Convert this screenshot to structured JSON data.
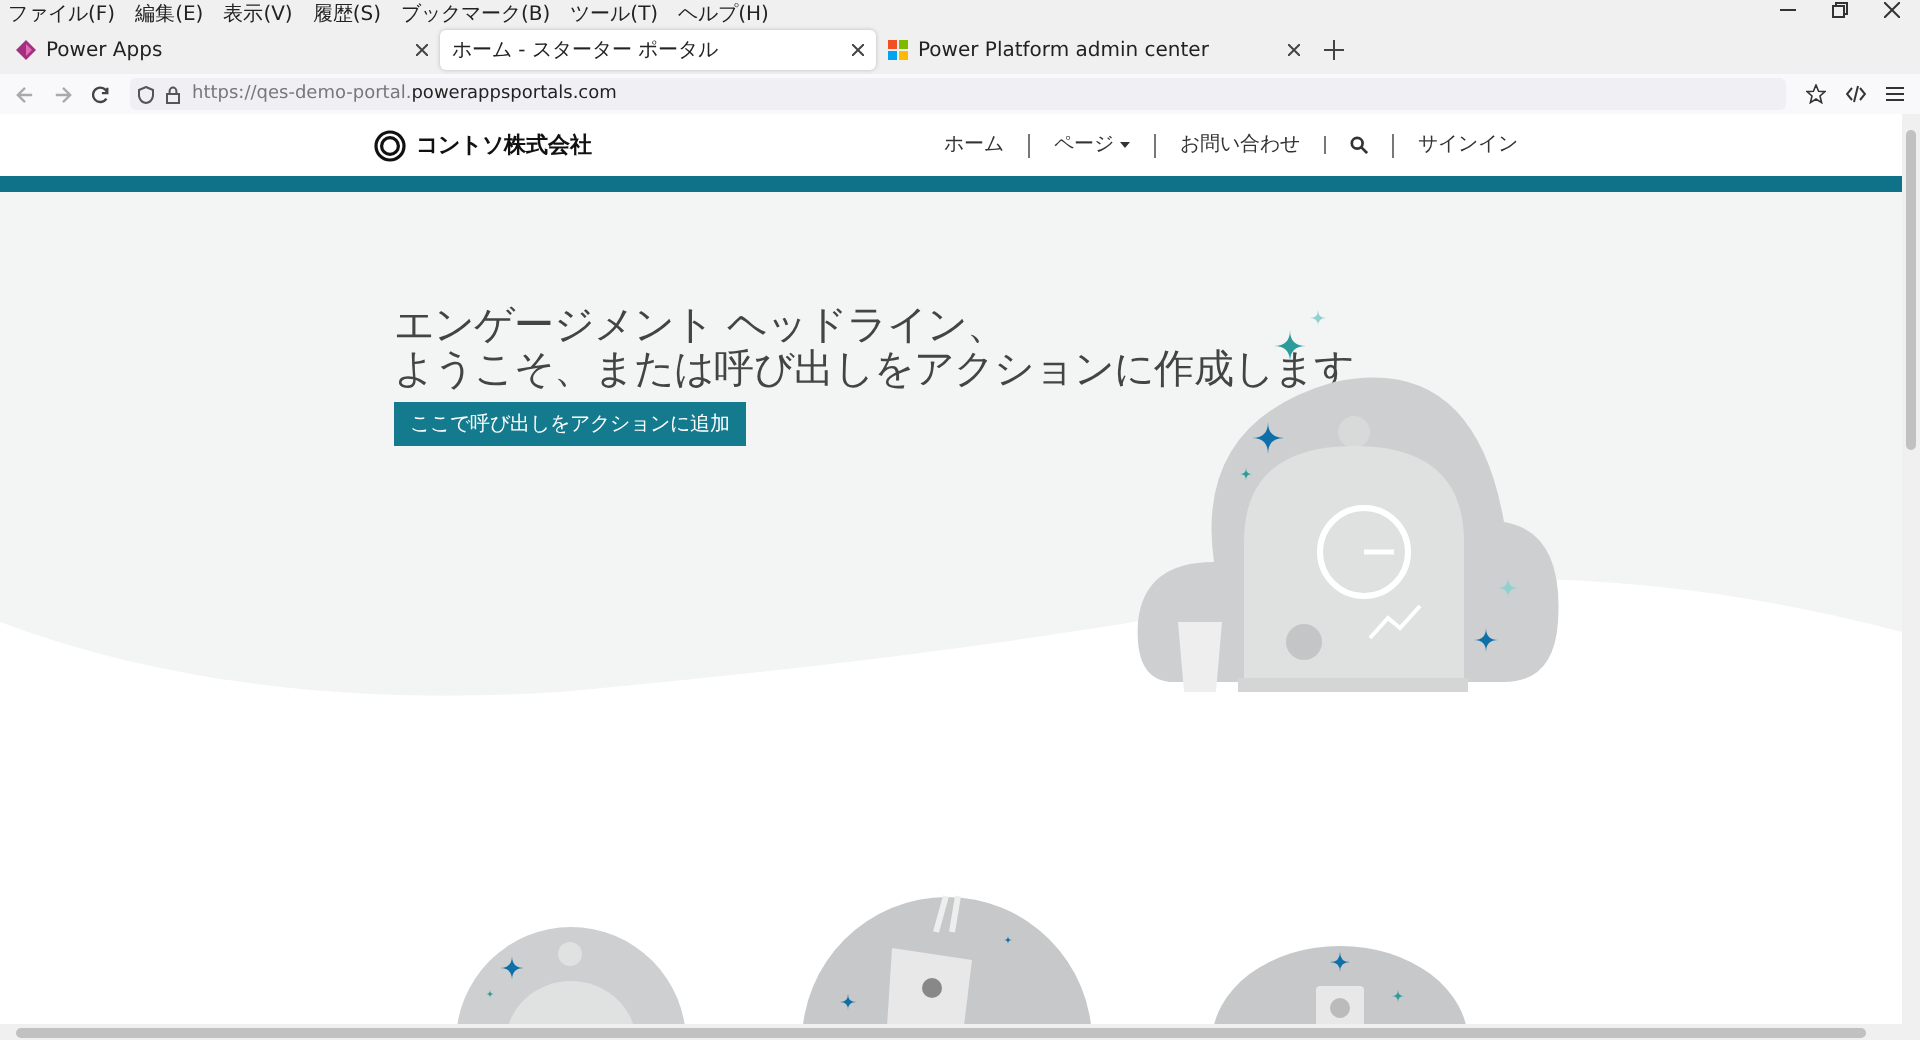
{
  "menu_bar": [
    "ファイル(F)",
    "編集(E)",
    "表示(V)",
    "履歴(S)",
    "ブックマーク(B)",
    "ツール(T)",
    "ヘルプ(H)"
  ],
  "tabs": [
    {
      "kind": "powerapps",
      "title": "Power Apps",
      "selected": false
    },
    {
      "kind": "blank",
      "title": "ホーム - スターター ポータル",
      "selected": true
    },
    {
      "kind": "microsoft",
      "title": "Power Platform admin center",
      "selected": false
    }
  ],
  "address_bar": {
    "url_prefix": "https://qes-demo-portal.",
    "url_domain": "powerappsportals.com"
  },
  "site_header": {
    "brand": "コントソ株式会社",
    "nav": [
      {
        "kind": "link",
        "label": "ホーム"
      },
      {
        "kind": "dropdown",
        "label": "ページ"
      },
      {
        "kind": "link",
        "label": "お問い合わせ"
      },
      {
        "kind": "search"
      },
      {
        "kind": "link",
        "label": "サインイン"
      }
    ]
  },
  "hero": {
    "title_lines": [
      "エンゲージメント ヘッドライン、",
      "ようこそ、または呼び出しをアクションに作成します"
    ],
    "button": "ここで呼び出しをアクションに追加"
  }
}
